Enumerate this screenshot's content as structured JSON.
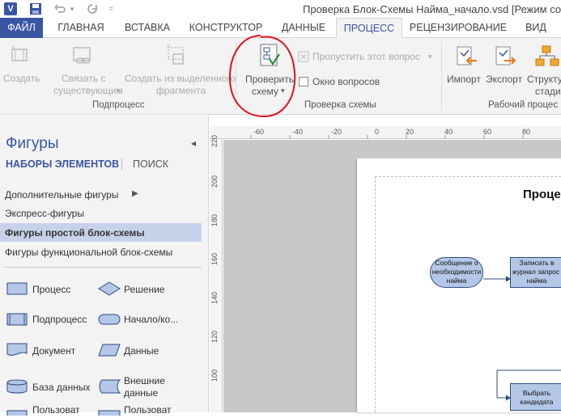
{
  "window": {
    "title": "Проверка Блок-Схемы Найма_начало.vsd  [Режим совме",
    "app_icon": "V"
  },
  "quick_access": {
    "save_icon": "save-icon",
    "undo_icon": "undo-icon",
    "redo_icon": "redo-icon"
  },
  "tabs": [
    {
      "label": "ФАЙЛ"
    },
    {
      "label": "ГЛАВНАЯ"
    },
    {
      "label": "ВСТАВКА"
    },
    {
      "label": "КОНСТРУКТОР"
    },
    {
      "label": "ДАННЫЕ"
    },
    {
      "label": "ПРОЦЕСС"
    },
    {
      "label": "РЕЦЕНЗИРОВАНИЕ"
    },
    {
      "label": "ВИД"
    }
  ],
  "ribbon": {
    "subprocess": {
      "create": "Создать",
      "link_line1": "Связать с",
      "link_line2": "существующим",
      "from_selection_line1": "Создать из выделенного",
      "from_selection_line2": "фрагмента",
      "group_label": "Подпроцесс"
    },
    "validation": {
      "check_line1": "Проверить",
      "check_line2": "схему",
      "skip_issue": "Пропустить этот вопрос",
      "issues_window": "Окно вопросов",
      "group_label": "Проверка схемы"
    },
    "workflow": {
      "import": "Импорт",
      "export": "Экспорт",
      "structure_line1": "Структу",
      "structure_line2": "стади",
      "group_label": "Рабочий процес"
    }
  },
  "shapes_pane": {
    "title": "Фигуры",
    "tab_stencils": "НАБОРЫ ЭЛЕМЕНТОВ",
    "tab_search": "ПОИСК",
    "stencils": [
      {
        "label": "Дополнительные фигуры"
      },
      {
        "label": "Экспресс-фигуры"
      },
      {
        "label": "Фигуры простой блок-схемы"
      },
      {
        "label": "Фигуры функциональной блок-схемы"
      }
    ],
    "shapes": [
      {
        "label": "Процесс"
      },
      {
        "label": "Решение"
      },
      {
        "label": "Подпроцесс"
      },
      {
        "label": "Начало/ко..."
      },
      {
        "label": "Документ"
      },
      {
        "label": "Данные"
      },
      {
        "label": "База данных"
      },
      {
        "label_line1": "Внешние",
        "label_line2": "данные"
      },
      {
        "label": "Пользоват"
      },
      {
        "label": "Пользоват"
      }
    ]
  },
  "rulers": {
    "top_ticks": [
      "-60",
      "-40",
      "-20",
      "0",
      "20",
      "40",
      "60",
      "80",
      "100",
      "120"
    ],
    "left_ticks": [
      "220",
      "200",
      "180",
      "160",
      "140",
      "120",
      "100",
      "80"
    ]
  },
  "diagram": {
    "title_fragment": "Проце",
    "shape1_line1": "Сообщение о",
    "shape1_line2": "необходимости",
    "shape1_line3": "найма",
    "shape2_line1": "Записать в",
    "shape2_line2": "журнал запрос",
    "shape2_line3": "найма",
    "shape3_line1": "Выбрать",
    "shape3_line2": "кандидата"
  },
  "colors": {
    "accent": "#3955a3",
    "annotation_red": "#e0101a",
    "shape_fill": "#b4c7e7",
    "shape_stroke": "#2f4a80"
  }
}
